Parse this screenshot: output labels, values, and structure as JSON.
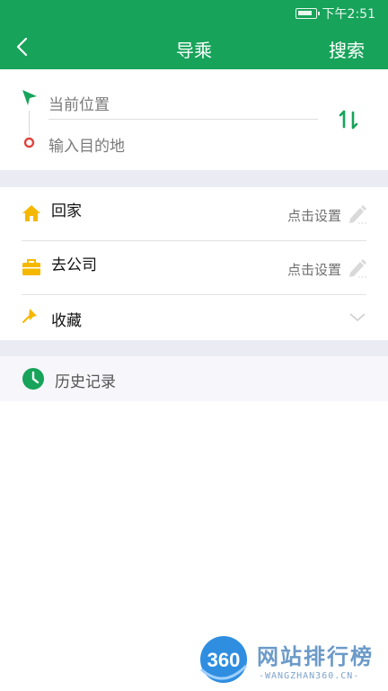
{
  "status_bar": {
    "time_prefix": "下午",
    "time": "2:51"
  },
  "header": {
    "title": "导乘",
    "search_label": "搜索"
  },
  "route": {
    "origin_placeholder": "当前位置",
    "destination_placeholder": "输入目的地"
  },
  "favorites": {
    "home_label": "回家",
    "home_setting": "点击设置",
    "company_label": "去公司",
    "company_setting": "点击设置",
    "collect_label": "收藏"
  },
  "history": {
    "label": "历史记录"
  },
  "watermark": {
    "logo_text": "360",
    "brand": "网站排行榜",
    "site": "-WANGZHAN360.CN-"
  },
  "colors": {
    "brand_green": "#17a35a",
    "home_yellow": "#f5b800",
    "destination_red": "#e0443c"
  }
}
